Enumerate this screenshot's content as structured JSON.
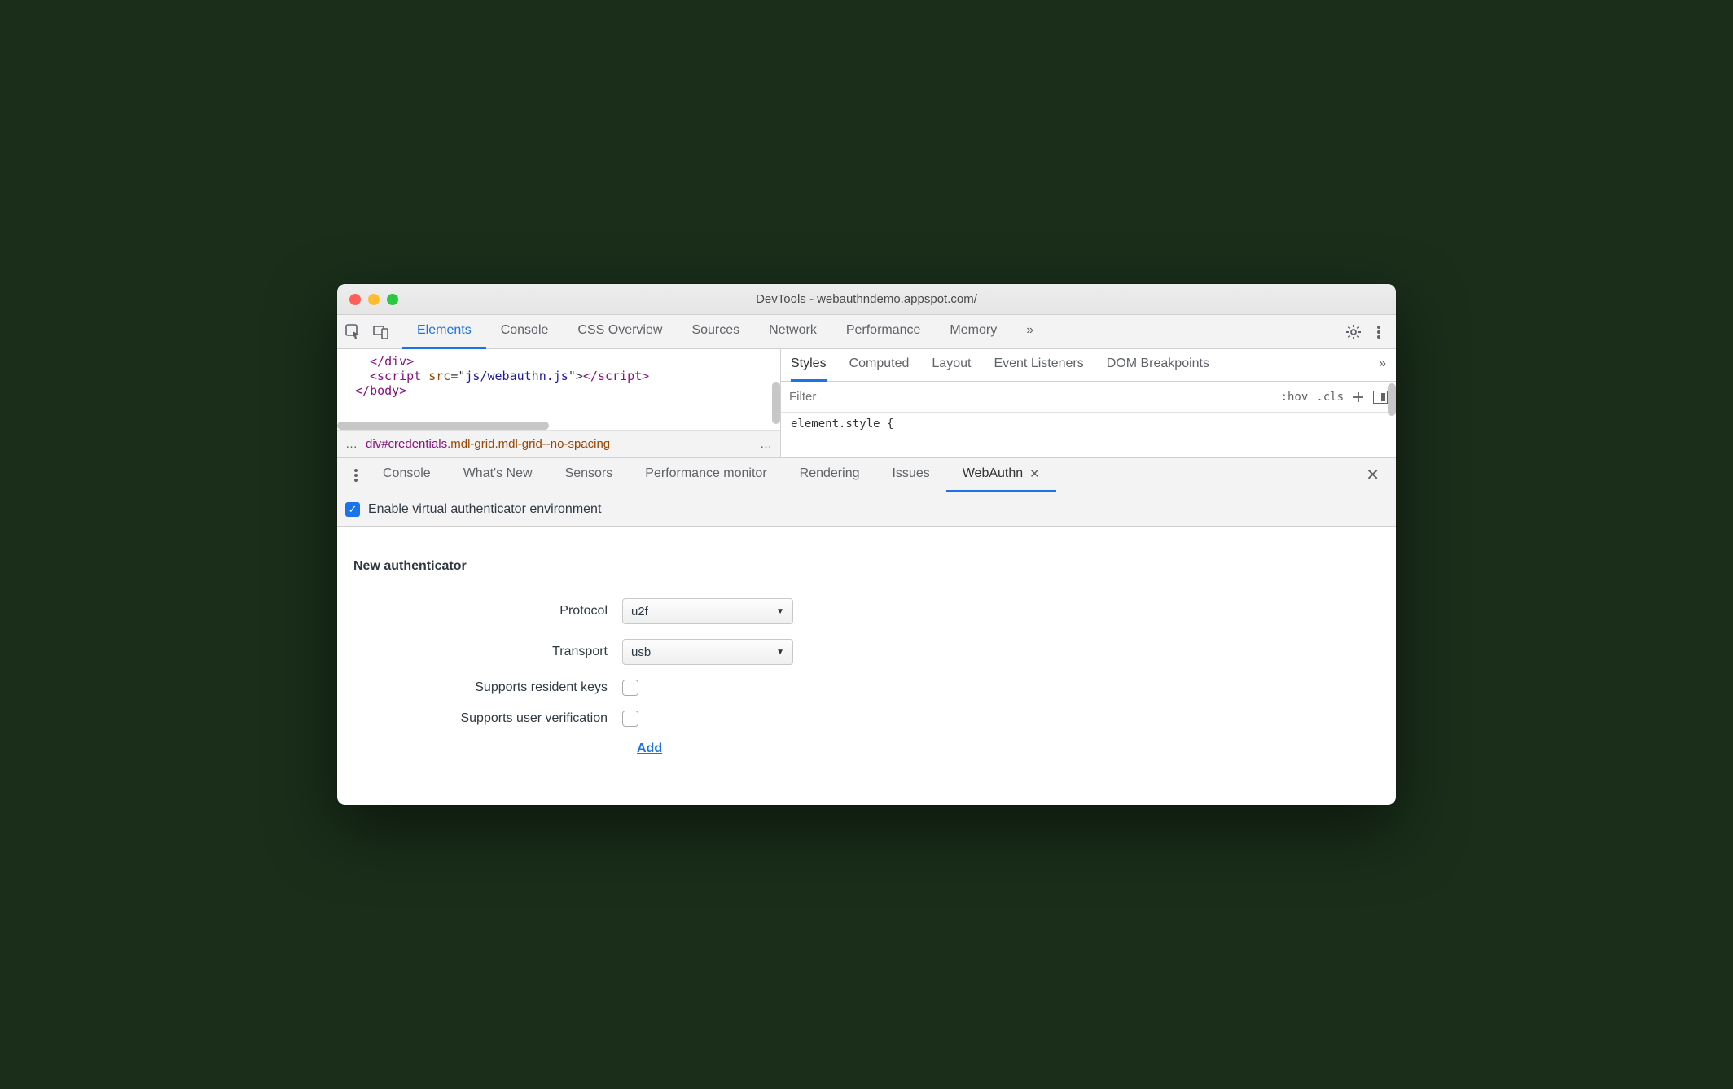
{
  "window": {
    "title": "DevTools - webauthndemo.appspot.com/"
  },
  "mainTabs": {
    "items": [
      "Elements",
      "Console",
      "CSS Overview",
      "Sources",
      "Network",
      "Performance",
      "Memory"
    ],
    "active": "Elements",
    "overflow": "»"
  },
  "code": {
    "line1_a": "</",
    "line1_b": "div",
    "line1_c": ">",
    "line2_a": "<",
    "line2_b": "script",
    "line2_c": " src",
    "line2_d": "=\"",
    "line2_e": "js/webauthn.js",
    "line2_f": "\">",
    "line2_g": "</",
    "line2_h": "script",
    "line2_i": ">",
    "line3_a": "</",
    "line3_b": "body",
    "line3_c": ">"
  },
  "breadcrumb": {
    "ellipsis_left": "…",
    "tag": "div",
    "id": "#credentials",
    "cls1": ".mdl-grid",
    "cls2": ".mdl-grid--no-spacing",
    "ellipsis_right": "…"
  },
  "sideTabs": {
    "items": [
      "Styles",
      "Computed",
      "Layout",
      "Event Listeners",
      "DOM Breakpoints"
    ],
    "active": "Styles",
    "overflow": "»"
  },
  "filter": {
    "placeholder": "Filter",
    "hov": ":hov",
    "cls": ".cls"
  },
  "styleRule": "element.style {",
  "drawerTabs": {
    "items": [
      "Console",
      "What's New",
      "Sensors",
      "Performance monitor",
      "Rendering",
      "Issues",
      "WebAuthn"
    ],
    "active": "WebAuthn"
  },
  "webauthn": {
    "enableLabel": "Enable virtual authenticator environment",
    "sectionTitle": "New authenticator",
    "protocolLabel": "Protocol",
    "protocolValue": "u2f",
    "transportLabel": "Transport",
    "transportValue": "usb",
    "residentLabel": "Supports resident keys",
    "userVerifyLabel": "Supports user verification",
    "addLabel": "Add"
  }
}
